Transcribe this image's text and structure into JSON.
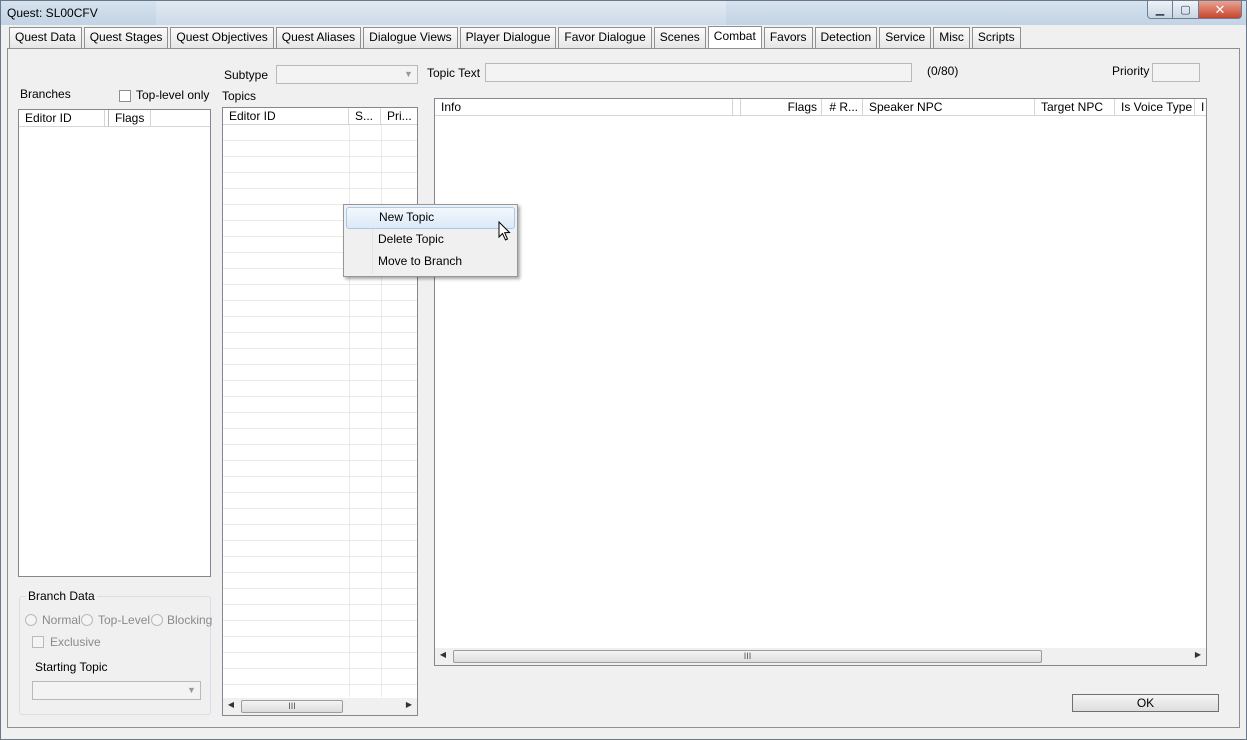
{
  "window": {
    "title": "Quest: SL00CFV"
  },
  "tabs": [
    {
      "label": "Quest Data",
      "active": false
    },
    {
      "label": "Quest Stages",
      "active": false
    },
    {
      "label": "Quest Objectives",
      "active": false
    },
    {
      "label": "Quest Aliases",
      "active": false
    },
    {
      "label": "Dialogue Views",
      "active": false
    },
    {
      "label": "Player Dialogue",
      "active": false
    },
    {
      "label": "Favor Dialogue",
      "active": false
    },
    {
      "label": "Scenes",
      "active": false
    },
    {
      "label": "Combat",
      "active": true
    },
    {
      "label": "Favors",
      "active": false
    },
    {
      "label": "Detection",
      "active": false
    },
    {
      "label": "Service",
      "active": false
    },
    {
      "label": "Misc",
      "active": false
    },
    {
      "label": "Scripts",
      "active": false
    }
  ],
  "branches": {
    "label": "Branches",
    "toplevel_only_label": "Top-level only",
    "columns": [
      "Editor ID",
      "Flags"
    ]
  },
  "branch_data": {
    "legend": "Branch Data",
    "radio_normal": "Normal",
    "radio_toplevel": "Top-Level",
    "radio_blocking": "Blocking",
    "exclusive_label": "Exclusive",
    "starting_topic_label": "Starting Topic"
  },
  "subtype_label": "Subtype",
  "topics": {
    "label": "Topics",
    "columns": [
      "Editor ID",
      "S...",
      "Pri..."
    ]
  },
  "topic_text": {
    "label": "Topic Text",
    "counter": "(0/80)"
  },
  "priority_label": "Priority",
  "info_list": {
    "columns": [
      "Info",
      "Flags",
      "# R...",
      "Speaker NPC",
      "Target NPC",
      "Is Voice Type",
      "I"
    ]
  },
  "context_menu": {
    "items": [
      "New Topic",
      "Delete Topic",
      "Move to Branch"
    ],
    "highlighted": "New Topic"
  },
  "ok_label": "OK",
  "scroll_grip": "III"
}
